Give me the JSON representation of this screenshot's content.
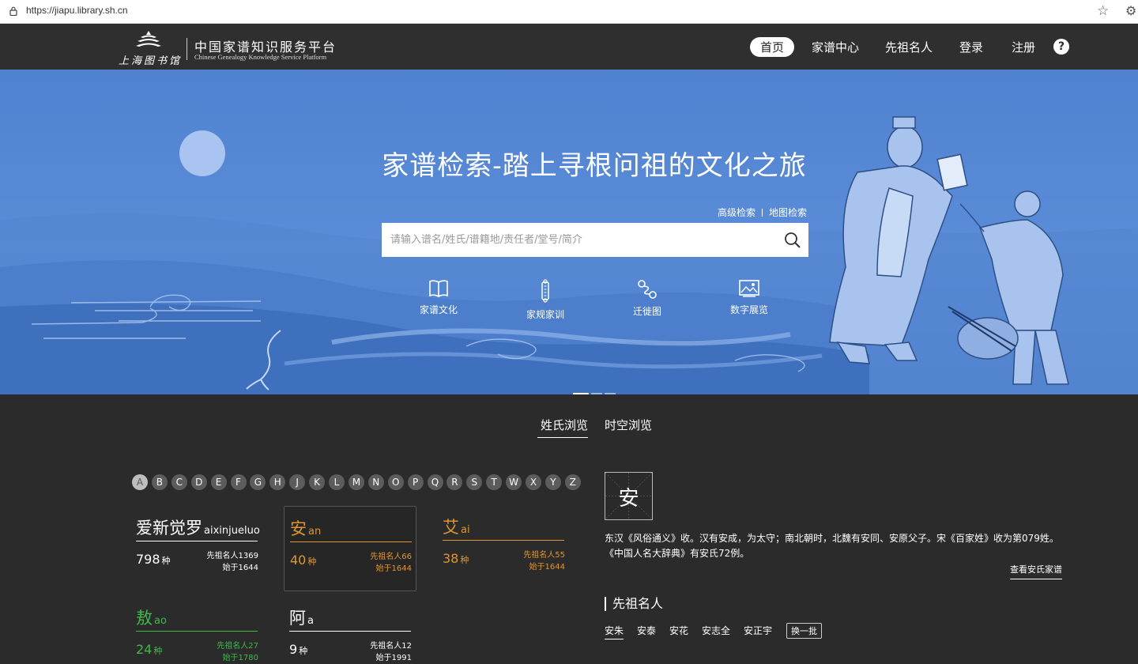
{
  "browser": {
    "url": "https://jiapu.library.sh.cn"
  },
  "header": {
    "library_name": "上海图书馆",
    "title_cn": "中国家谱知识服务平台",
    "title_en": "Chinese Genealogy Knowledge Service Platform",
    "nav": [
      "首页",
      "家谱中心",
      "先祖名人",
      "登录",
      "注册"
    ],
    "help": "?"
  },
  "hero": {
    "slogan": "家谱检索-踏上寻根问祖的文化之旅",
    "advanced_search": "高级检索",
    "map_search": "地图检索",
    "search_placeholder": "请输入谱名/姓氏/谱籍地/责任者/堂号/简介",
    "quick_links": [
      "家谱文化",
      "家规家训",
      "迁徙图",
      "数字展览"
    ]
  },
  "browse": {
    "tabs": [
      "姓氏浏览",
      "时空浏览"
    ],
    "letters": [
      "A",
      "B",
      "C",
      "D",
      "E",
      "F",
      "G",
      "H",
      "J",
      "K",
      "L",
      "M",
      "N",
      "O",
      "P",
      "Q",
      "R",
      "S",
      "T",
      "W",
      "X",
      "Y",
      "Z"
    ],
    "selected_letter": "A",
    "surnames": [
      {
        "name": "爱新觉罗",
        "pinyin": "aixinjueluo",
        "count": "798",
        "unit": "种",
        "famous": "先祖名人1369",
        "since": "始于1644"
      },
      {
        "name": "安",
        "pinyin": "an",
        "count": "40",
        "unit": "种",
        "famous": "先祖名人66",
        "since": "始于1644"
      },
      {
        "name": "艾",
        "pinyin": "ai",
        "count": "38",
        "unit": "种",
        "famous": "先祖名人55",
        "since": "始于1644"
      },
      {
        "name": "敖",
        "pinyin": "ao",
        "count": "24",
        "unit": "种",
        "famous": "先祖名人27",
        "since": "始于1780"
      },
      {
        "name": "阿",
        "pinyin": "a",
        "count": "9",
        "unit": "种",
        "famous": "先祖名人12",
        "since": "始于1991"
      }
    ]
  },
  "detail": {
    "character": "安",
    "description": "东汉《风俗通义》收。汉有安成，为太守；南北朝时，北魏有安同、安原父子。宋《百家姓》收为第079姓。《中国人名大辞典》有安氏72例。",
    "view_more": "查看安氏家谱",
    "ancestors_title": "先祖名人",
    "ancestors": [
      "安朱",
      "安泰",
      "安花",
      "安志全",
      "安正宇"
    ],
    "refresh": "换一批"
  },
  "colors": {
    "nav_bg": "#2f2f2f",
    "page_bg": "#2b2b2b",
    "hero_blue": "#5b8cd8",
    "surname_white": "#ffffff",
    "surname_orange": "#e0962e",
    "surname_green": "#3fb84a"
  }
}
